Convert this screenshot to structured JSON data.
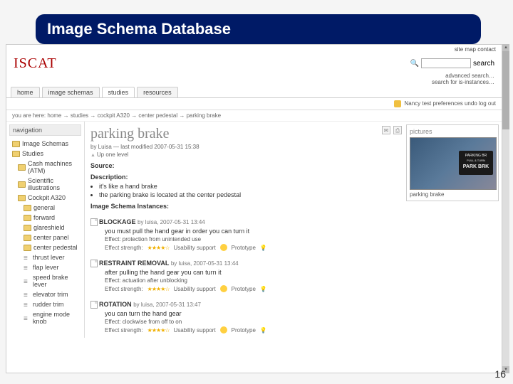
{
  "slide": {
    "title": "Image Schema Database",
    "page_num": "16"
  },
  "header": {
    "top_links": "site map  contact",
    "logo": "ISCAT",
    "search_label": "search",
    "search_placeholder": "",
    "search_sub": "advanced search…\nsearch for is-instances…",
    "tabs": [
      "home",
      "image schemas",
      "studies",
      "resources"
    ],
    "active_tab": 2,
    "user_row": "Nancy test   preferences   undo   log out",
    "breadcrumb": "you are here: home  →  studies  →  cockpit A320  →  center pedestal  →  parking brake"
  },
  "sidebar": {
    "head": "navigation",
    "items": [
      {
        "label": "Image Schemas",
        "type": "folder",
        "lvl": 1
      },
      {
        "label": "Studies",
        "type": "folder",
        "lvl": 1
      },
      {
        "label": "Cash machines (ATM)",
        "type": "folder",
        "lvl": 2
      },
      {
        "label": "Scientific illustrations",
        "type": "folder",
        "lvl": 2
      },
      {
        "label": "Cockpit A320",
        "type": "folder",
        "lvl": 2
      },
      {
        "label": "general",
        "type": "folder",
        "lvl": 3
      },
      {
        "label": "forward",
        "type": "folder",
        "lvl": 3
      },
      {
        "label": "glareshield",
        "type": "folder",
        "lvl": 3
      },
      {
        "label": "center panel",
        "type": "folder",
        "lvl": 3
      },
      {
        "label": "center pedestal",
        "type": "folder",
        "lvl": 3
      },
      {
        "label": "thrust lever",
        "type": "list",
        "lvl": 3
      },
      {
        "label": "flap lever",
        "type": "list",
        "lvl": 3
      },
      {
        "label": "speed brake lever",
        "type": "list",
        "lvl": 3
      },
      {
        "label": "elevator trim",
        "type": "list",
        "lvl": 3
      },
      {
        "label": "rudder trim",
        "type": "list",
        "lvl": 3
      },
      {
        "label": "engine mode knob",
        "type": "list",
        "lvl": 3
      }
    ]
  },
  "content": {
    "title": "parking brake",
    "byline": "by Luisa — last modified 2007-05-31 15:38",
    "uplink": "Up one level",
    "source_head": "Source:",
    "desc_head": "Description:",
    "bullets": [
      "it's like a hand brake",
      "the parking brake is located at the center pedestal"
    ],
    "inst_head": "Image Schema Instances:",
    "instances": [
      {
        "name": "BLOCKAGE",
        "meta": "by luisa, 2007-05-31 13:44",
        "body": "you must pull the hand gear in order you can turn it",
        "effect": "Effect: protection from unintended use",
        "strength": "Effect strength:",
        "usab": "Usability support",
        "proto": "Prototype"
      },
      {
        "name": "RESTRAINT REMOVAL",
        "meta": "by luisa, 2007-05-31 13:44",
        "body": "after pulling the hand gear you can turn it",
        "effect": "Effect: actuation after unblocking",
        "strength": "Effect strength:",
        "usab": "Usability support",
        "proto": "Prototype"
      },
      {
        "name": "ROTATION",
        "meta": "by luisa, 2007-05-31 13:47",
        "body": "you can turn the hand gear",
        "effect": "Effect: clockwise from off to on",
        "strength": "Effect strength:",
        "usab": "Usability support",
        "proto": "Prototype"
      }
    ],
    "picture": {
      "head": "pictures",
      "label_top": "PARKING BR",
      "label_sub": "PULL & TURN",
      "big": "PARK BRK",
      "caption": "parking brake"
    }
  }
}
